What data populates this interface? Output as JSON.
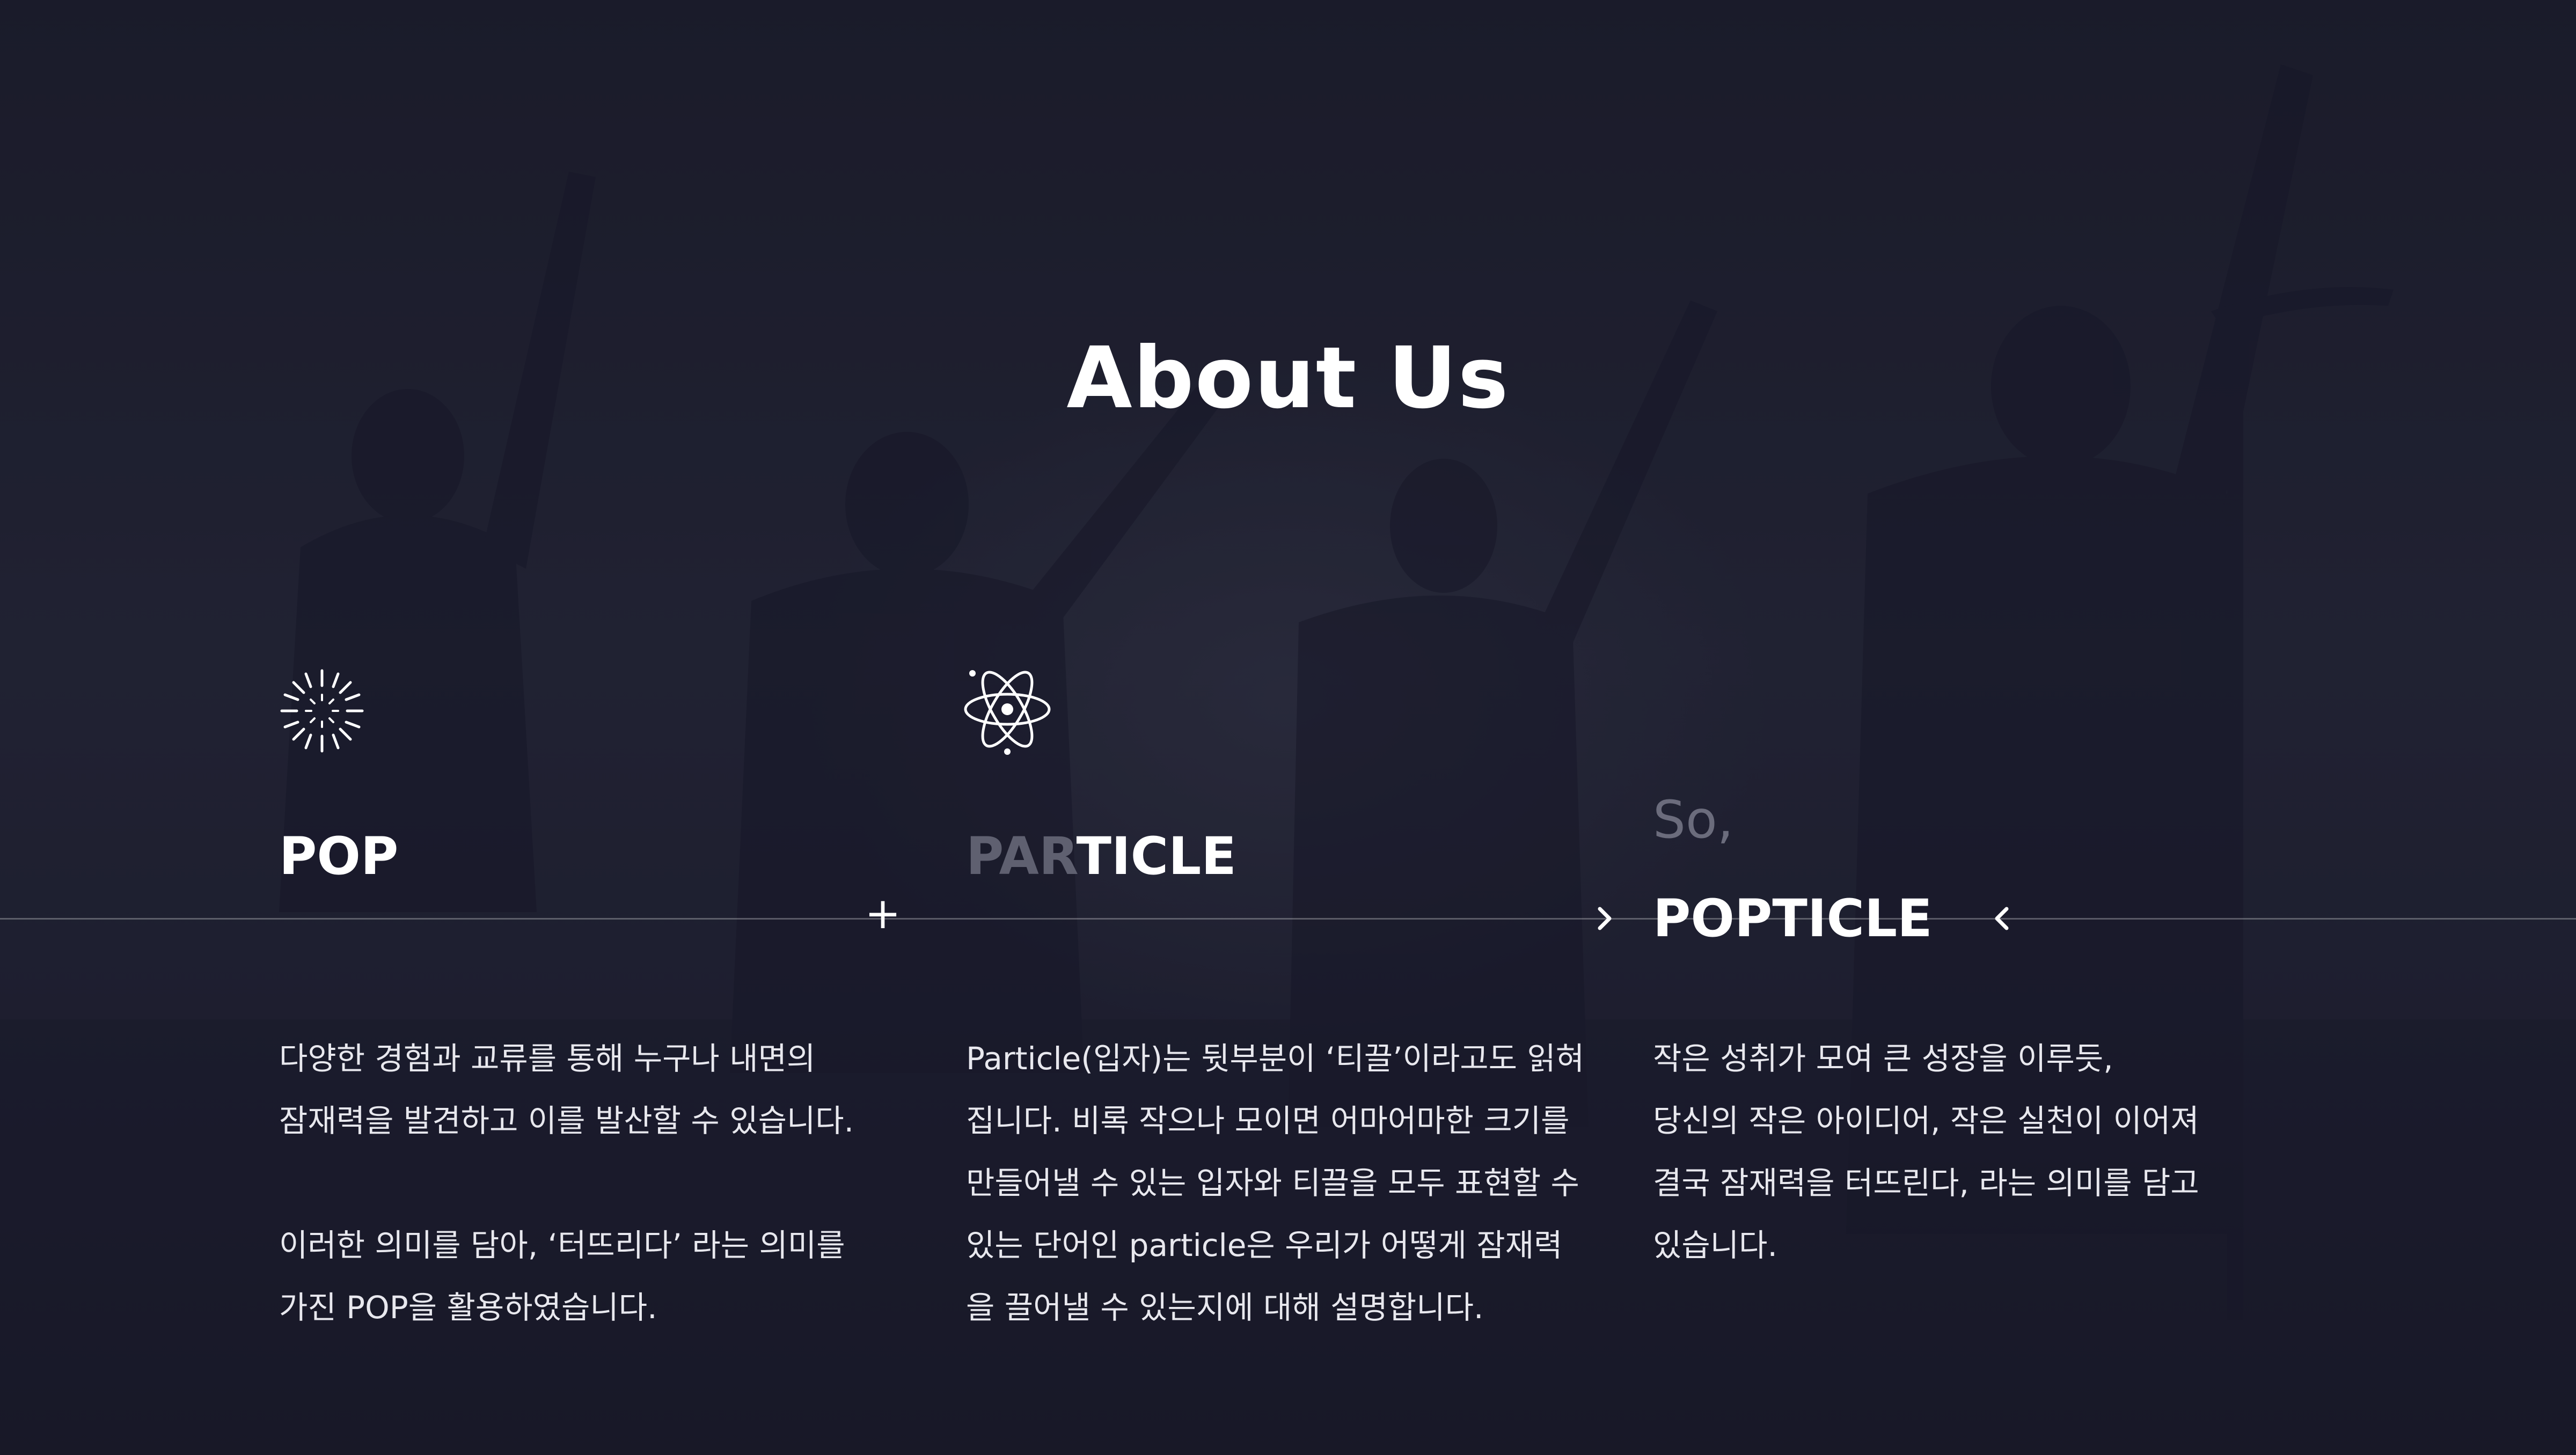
{
  "page": {
    "title": "About Us"
  },
  "icons": {
    "pop_icon": "firework-burst-icon",
    "particle_icon": "atom-icon",
    "arrow_right": "chevron-right-icon",
    "arrow_left": "chevron-left-icon"
  },
  "colors": {
    "background": "#1c1d2b",
    "text": "#ffffff",
    "dim_text": "#5f6070",
    "so_text": "#6b6c7c",
    "divider": "rgba(255,255,255,0.28)"
  },
  "pop": {
    "heading": "POP",
    "lines_1": [
      "다양한 경험과 교류를 통해 누구나 내면의",
      "잠재력을 발견하고 이를 발산할 수 있습니다."
    ],
    "lines_2": [
      "이러한 의미를 담아, ‘터뜨리다’ 라는 의미를",
      "가진 POP을 활용하였습니다."
    ]
  },
  "connector": {
    "plus": "+"
  },
  "particle": {
    "heading_dim": "PAR",
    "heading_bright": "TICLE",
    "lines": [
      "Particle(입자)는 뒷부분이 ‘티끌’이라고도 읽혀",
      "집니다. 비록 작으나 모이면 어마어마한 크기를",
      "만들어낼 수 있는 입자와 티끌을 모두 표현할 수",
      "있는 단어인 particle은 우리가 어떻게 잠재력",
      "을 끌어낼 수 있는지에 대해 설명합니다."
    ]
  },
  "popticle": {
    "prefix": "So,",
    "heading": "POPTICLE",
    "lines": [
      "작은 성취가 모여 큰 성장을 이루듯,",
      "당신의 작은 아이디어, 작은 실천이 이어져",
      "결국 잠재력을 터뜨린다, 라는 의미를 담고",
      "있습니다."
    ]
  }
}
